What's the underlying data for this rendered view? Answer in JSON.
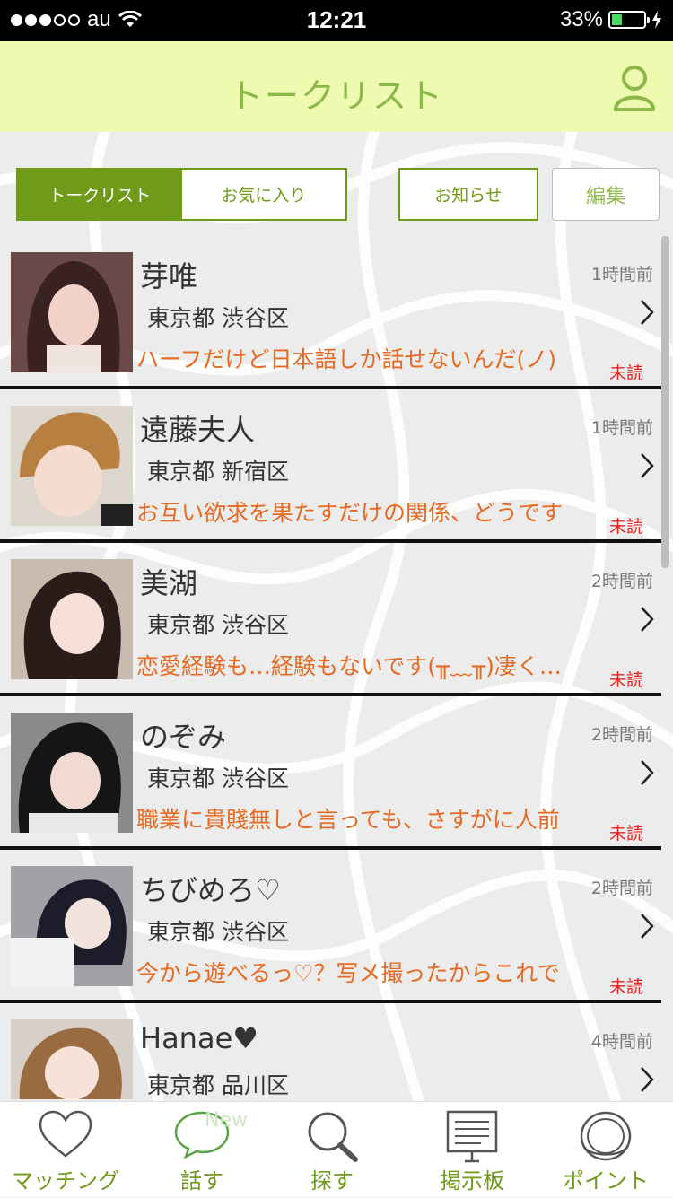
{
  "status": {
    "carrier": "au",
    "time": "12:21",
    "battery": "33%"
  },
  "header": {
    "title": "トークリスト"
  },
  "tabs": [
    {
      "label": "トークリスト",
      "active": true
    },
    {
      "label": "お気に入り",
      "active": false
    }
  ],
  "buttons": {
    "notice": "お知らせ",
    "edit": "編集"
  },
  "conversations": [
    {
      "name": "芽唯",
      "location": "東京都 渋谷区",
      "time": "1時間前",
      "message": "ハーフだけど日本語しか話せないんだ(ノ)",
      "status": "未読"
    },
    {
      "name": "遠藤夫人",
      "location": "東京都 新宿区",
      "time": "1時間前",
      "message": "お互い欲求を果たすだけの関係、どうです",
      "status": "未読"
    },
    {
      "name": "美湖",
      "location": "東京都 渋谷区",
      "time": "2時間前",
      "message": "恋愛経験も…経験もないです(╥﹏╥)凄く…",
      "status": "未読"
    },
    {
      "name": "のぞみ",
      "location": "東京都 渋谷区",
      "time": "2時間前",
      "message": "職業に貴賤無しと言っても、さすがに人前",
      "status": "未読"
    },
    {
      "name": "ちびめろ♡",
      "location": "東京都 渋谷区",
      "time": "2時間前",
      "message": "今から遊べるっ♡？写メ撮ったからこれで",
      "status": "未読"
    },
    {
      "name": "Hanae♥",
      "location": "東京都 品川区",
      "time": "4時間前",
      "message": "",
      "status": ""
    }
  ],
  "tabbar": {
    "matching": "マッチング",
    "talk": "話す",
    "talk_badge": "New",
    "search": "探す",
    "board": "掲示板",
    "points": "ポイント"
  },
  "colors": {
    "header_bg": "#eefab0",
    "accent": "#6f9a1a",
    "title_green": "#8cb84a",
    "message_orange": "#e66a22",
    "unread_red": "#e62222"
  }
}
